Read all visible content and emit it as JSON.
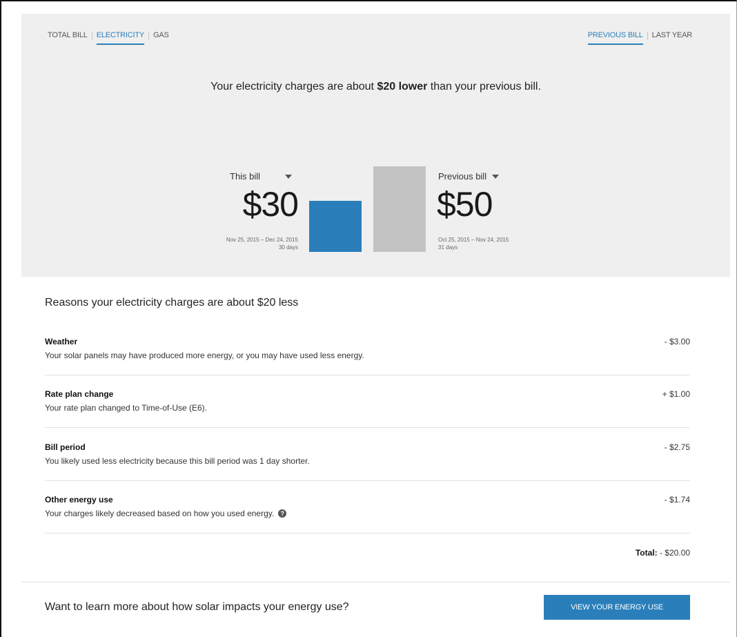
{
  "tabs": {
    "left": [
      "TOTAL BILL",
      "ELECTRICITY",
      "GAS"
    ],
    "left_active": "ELECTRICITY",
    "right": [
      "PREVIOUS BILL",
      "LAST YEAR"
    ],
    "right_active": "PREVIOUS BILL"
  },
  "headline": {
    "prefix": "Your electricity charges are about ",
    "emphasis": "$20 lower",
    "suffix": " than your previous bill."
  },
  "this_bill": {
    "label": "This bill",
    "amount": "$30",
    "value": 30,
    "date_range": "Nov 25, 2015 – Dec 24, 2015",
    "days": "30 days"
  },
  "previous_bill": {
    "label": "Previous bill",
    "amount": "$50",
    "value": 50,
    "date_range": "Oct 25, 2015 – Nov 24, 2015",
    "days": "31 days"
  },
  "colors": {
    "accent": "#2a7fba",
    "previous_bar": "#c3c3c3",
    "panel": "#efefef"
  },
  "reasons": {
    "title": "Reasons your electricity charges are about $20 less",
    "items": [
      {
        "title": "Weather",
        "description": "Your solar panels may have produced more energy, or you may have used less energy.",
        "amount": "- $3.00"
      },
      {
        "title": "Rate plan change",
        "description": "Your rate plan changed to Time-of-Use (E6).",
        "amount": "+ $1.00"
      },
      {
        "title": "Bill period",
        "description": "You likely used less electricity because this bill period was 1 day shorter.",
        "amount": "- $2.75"
      },
      {
        "title": "Other energy use",
        "description": "Your charges likely decreased based on how you used energy.",
        "amount": "- $1.74",
        "icon": "help-icon"
      }
    ],
    "total_label": "Total:",
    "total_value": " - $20.00"
  },
  "footer": {
    "text": "Want to learn more about how solar impacts your energy use?",
    "button": "VIEW YOUR ENERGY USE"
  }
}
